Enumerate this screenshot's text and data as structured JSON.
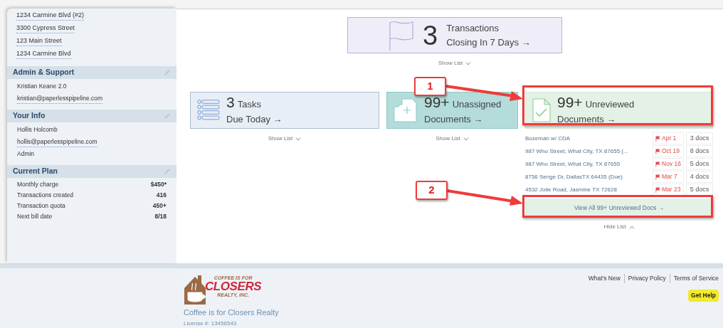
{
  "sidebar": {
    "links": [
      "1234 Carmine Blvd (#2)",
      "3300 Cypress Street",
      "123 Main Street",
      "1234 Carmine Blvd"
    ],
    "sections": [
      {
        "title": "Admin & Support",
        "rows": [
          {
            "kind": "text",
            "label": "Kristian Keane 2.0"
          },
          {
            "kind": "link",
            "label": "kristian@paperlesspipeline.com"
          }
        ]
      },
      {
        "title": "Your Info",
        "rows": [
          {
            "kind": "text",
            "label": "Hollis Holcomb"
          },
          {
            "kind": "link",
            "label": "hollis@paperlesspipeline.com"
          },
          {
            "kind": "text",
            "label": "Admin"
          }
        ]
      },
      {
        "title": "Current Plan",
        "rows": [
          {
            "kind": "pair",
            "label": "Monthly charge",
            "value": "$450*"
          },
          {
            "kind": "pair",
            "label": "Transactions created",
            "value": "416"
          },
          {
            "kind": "pair",
            "label": "Transaction quota",
            "value": "450+"
          },
          {
            "kind": "pair",
            "label": "Next bill date",
            "value": "8/18"
          }
        ]
      }
    ]
  },
  "closing": {
    "count": "3",
    "title": "Transactions",
    "link": "Closing In 7 Days →",
    "toggle": "Show List",
    "expanded": false
  },
  "cards": [
    {
      "kind": "tasks",
      "count": "3",
      "title": "Tasks",
      "link": "Due Today →",
      "toggle": "Show List",
      "expanded": false
    },
    {
      "kind": "unassigned",
      "count": "99+",
      "title": "Unassigned",
      "link": "Documents →",
      "toggle": "Show List",
      "expanded": false
    },
    {
      "kind": "unreviewed",
      "count": "99+",
      "title": "Unreviewed",
      "link": "Documents →",
      "toggle": "Hide List",
      "expanded": true,
      "rows": [
        {
          "address": "Bozeman w/ CDA",
          "date": "Apr 1",
          "docs": "3 docs"
        },
        {
          "address": "987 Who Street, What City, TX 87655 (...",
          "date": "Oct 19",
          "docs": "8 docs"
        },
        {
          "address": "987 Who Street, What City, TX 87655",
          "date": "Nov 16",
          "docs": "5 docs"
        },
        {
          "address": "8756 Senge Dr, DallasTX 64435 (Doe)",
          "date": "Mar 7",
          "docs": "4 docs"
        },
        {
          "address": "4532 Jolie Road, Jasmine TX 72628",
          "date": "Mar 23",
          "docs": "5 docs"
        }
      ],
      "view_all": "View All 99+ Unreviewed Docs →"
    }
  ],
  "callouts": [
    {
      "label": "1"
    },
    {
      "label": "2"
    }
  ],
  "footer": {
    "logo": [
      "COFFEE IS FOR",
      "CLOSERS",
      "REALTY, INC."
    ],
    "company": "Coffee is for Closers Realty",
    "license": "License #: 13456543",
    "links": [
      "What's New",
      "Privacy Policy",
      "Terms of Service"
    ],
    "help": "Get Help"
  }
}
